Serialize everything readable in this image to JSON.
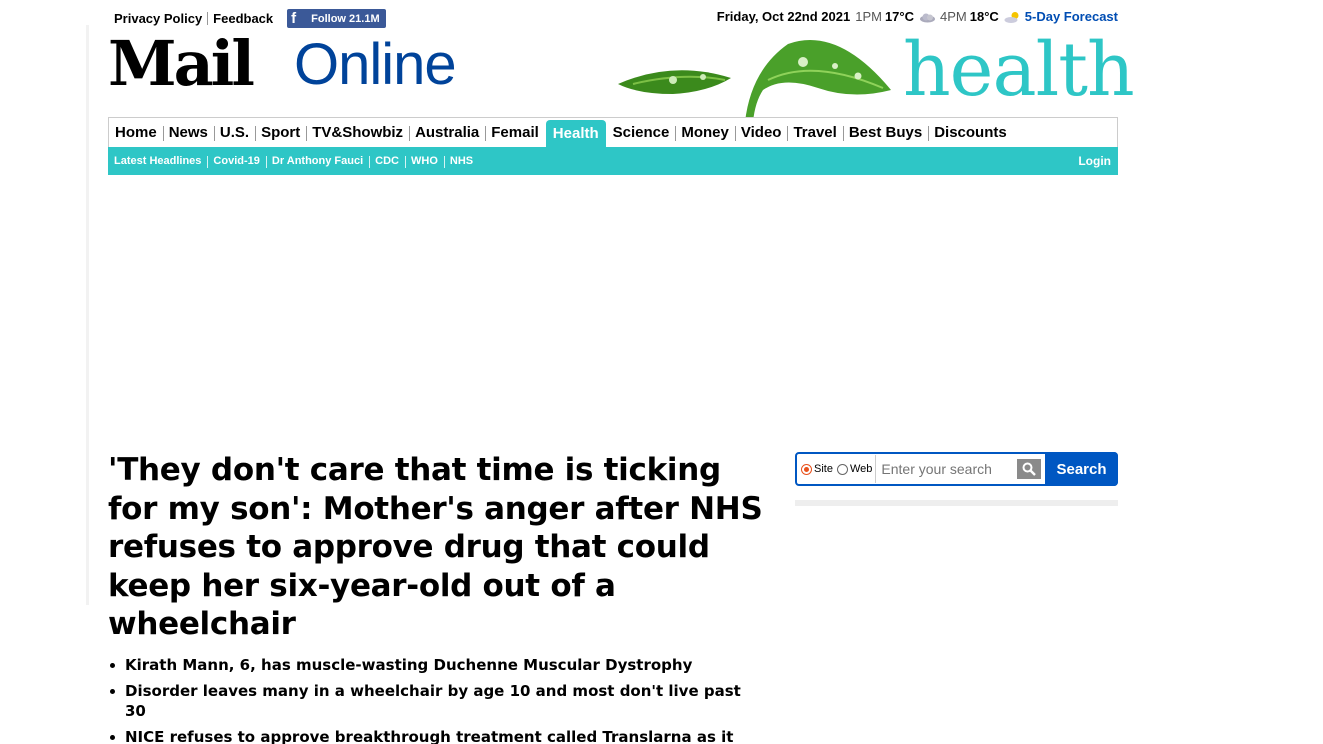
{
  "topbar": {
    "privacy": "Privacy Policy",
    "feedback": "Feedback",
    "follow": "Follow 21.1M",
    "date": "Friday, Oct 22nd 2021",
    "time1": "1PM",
    "temp1": "17°C",
    "time2": "4PM",
    "temp2": "18°C",
    "forecast": "5-Day Forecast"
  },
  "masthead": {
    "mail": "Mail",
    "online": "Online",
    "section": "health"
  },
  "nav": {
    "items": [
      "Home",
      "News",
      "U.S.",
      "Sport",
      "TV&Showbiz",
      "Australia",
      "Femail",
      "Health",
      "Science",
      "Money",
      "Video",
      "Travel",
      "Best Buys",
      "Discounts"
    ],
    "active": "Health"
  },
  "subnav": {
    "items": [
      "Latest Headlines",
      "Covid-19",
      "Dr Anthony Fauci",
      "CDC",
      "WHO",
      "NHS"
    ],
    "login": "Login"
  },
  "article": {
    "headline": "'They don't care that time is ticking for my son': Mother's anger after NHS refuses to approve drug that could keep her six-year-old out of a wheelchair",
    "bullets": [
      "Kirath Mann, 6, has muscle-wasting Duchenne Muscular Dystrophy",
      "Disorder leaves many in a wheelchair by age 10 and most don't live past 30",
      "NICE refuses to approve breakthrough treatment called Translarna as it says there is not enough evidence that it provides value for money"
    ]
  },
  "search": {
    "site_label": "Site",
    "web_label": "Web",
    "placeholder": "Enter your search",
    "button": "Search",
    "selected": "Site"
  },
  "colors": {
    "accent": "#2ec6c6",
    "brand_blue": "#00439a",
    "search_blue": "#0057c2",
    "facebook": "#3b5998"
  }
}
